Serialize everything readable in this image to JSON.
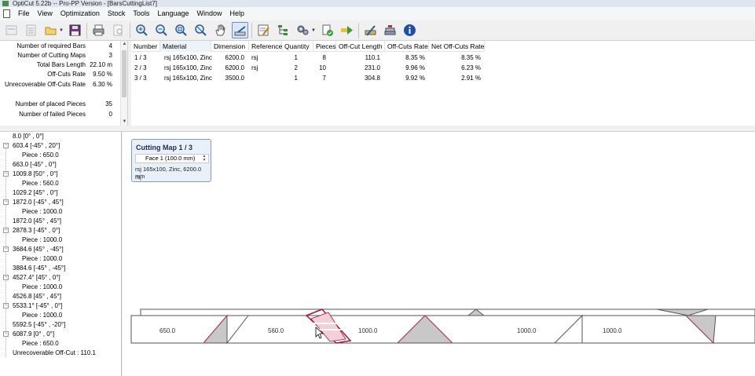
{
  "window": {
    "title": "OptiCut 5.22b -- Pro-PP Version - [BarsCuttingList7]"
  },
  "menu": [
    "File",
    "View",
    "Optimization",
    "Stock",
    "Tools",
    "Language",
    "Window",
    "Help"
  ],
  "toolbar": {
    "icons": [
      "new-bar-icon",
      "new-list-icon",
      "open-folder-icon",
      "save-icon",
      "print-icon",
      "print-preview-icon",
      "zoom-in-icon",
      "zoom-out-icon",
      "zoom-window-icon",
      "zoom-fit-icon",
      "pan-hand-icon",
      "measure-cut-icon",
      "edit-parameters-icon",
      "optimization-tree-icon",
      "optimize-gears-icon",
      "validate-document-icon",
      "export-arrow-icon",
      "cutting-list-icon",
      "stock-list-icon",
      "info-icon"
    ]
  },
  "stats": [
    {
      "label": "Number of required Bars",
      "value": "4"
    },
    {
      "label": "Number of Cutting Maps",
      "value": "3"
    },
    {
      "label": "Total Bars Length",
      "value": "22.10 m"
    },
    {
      "label": "Off-Cuts Rate",
      "value": "9.50 %"
    },
    {
      "label": "Unrecoverable Off-Cuts Rate",
      "value": "6.30 %"
    },
    {
      "label": "Number of placed Pieces",
      "value": "35"
    },
    {
      "label": "Number of failed Pieces",
      "value": "0"
    }
  ],
  "grid": {
    "headers": [
      "Number",
      "Material",
      "Dimension",
      "Reference",
      "Quantity",
      "Pieces",
      "Off-Cut Length",
      "Off-Cuts Rate",
      "Net Off-Cuts Rate"
    ],
    "rows": [
      [
        "1 / 3",
        "rsj 165x100, Zinc",
        "6200.0",
        "rsj",
        "1",
        "8",
        "110.1",
        "8.35 %",
        "8.35 %"
      ],
      [
        "2 / 3",
        "rsj 165x100, Zinc",
        "6200.0",
        "rsj",
        "2",
        "10",
        "231.0",
        "9.96 %",
        "6.23 %"
      ],
      [
        "3 / 3",
        "rsj 165x100, Zinc",
        "3500.0",
        "",
        "1",
        "7",
        "304.8",
        "9.92 %",
        "2.91 %"
      ]
    ]
  },
  "tree": [
    {
      "text": "8.0 [0° , 0°]",
      "level": 0,
      "expander": false
    },
    {
      "text": "603.4 [-45° , 20°]",
      "level": 0,
      "expander": true
    },
    {
      "text": "Piece : 650.0",
      "level": 1,
      "expander": false
    },
    {
      "text": "663.0 [-45° , 0°]",
      "level": 0,
      "expander": false
    },
    {
      "text": "1009.8 [50° , 0°]",
      "level": 0,
      "expander": true
    },
    {
      "text": "Piece : 560.0",
      "level": 1,
      "expander": false
    },
    {
      "text": "1029.2 [45° , 0°]",
      "level": 0,
      "expander": false
    },
    {
      "text": "1872.0 [-45° , 45°]",
      "level": 0,
      "expander": true
    },
    {
      "text": "Piece : 1000.0",
      "level": 1,
      "expander": false
    },
    {
      "text": "1872.0 [45° , 45°]",
      "level": 0,
      "expander": false
    },
    {
      "text": "2878.3 [-45° , 0°]",
      "level": 0,
      "expander": true
    },
    {
      "text": "Piece : 1000.0",
      "level": 1,
      "expander": false
    },
    {
      "text": "3684.6 [45° , -45°]",
      "level": 0,
      "expander": true
    },
    {
      "text": "Piece : 1000.0",
      "level": 1,
      "expander": false
    },
    {
      "text": "3884.6 [-45° , -45°]",
      "level": 0,
      "expander": false
    },
    {
      "text": "4527.4° [45° , 0°]",
      "level": 0,
      "expander": true
    },
    {
      "text": "Piece : 1000.0",
      "level": 1,
      "expander": false
    },
    {
      "text": "4526.8 [45° , 45°]",
      "level": 0,
      "expander": false
    },
    {
      "text": "5533.1° [-45° , 0°]",
      "level": 0,
      "expander": true
    },
    {
      "text": "Piece : 1000.0",
      "level": 1,
      "expander": false
    },
    {
      "text": "5592.5 [-45° , -20°]",
      "level": 0,
      "expander": false
    },
    {
      "text": "6087.9 [0° , 0°]",
      "level": 0,
      "expander": true
    },
    {
      "text": "Piece : 650.0",
      "level": 1,
      "expander": false
    },
    {
      "text": "Unrecoverable Off-Cut : 110.1",
      "level": 0,
      "expander": false
    }
  ],
  "cutting_map": {
    "title": "Cutting Map 1 / 3",
    "face": "Face 1  (100.0 mm)",
    "material_line": "rsj 165x100, Zinc, 6200.0 mm",
    "reference_line": "rsj",
    "piece_labels": [
      "650.0",
      "560.0",
      "1000.0",
      "1000.0",
      "1000.0"
    ]
  }
}
